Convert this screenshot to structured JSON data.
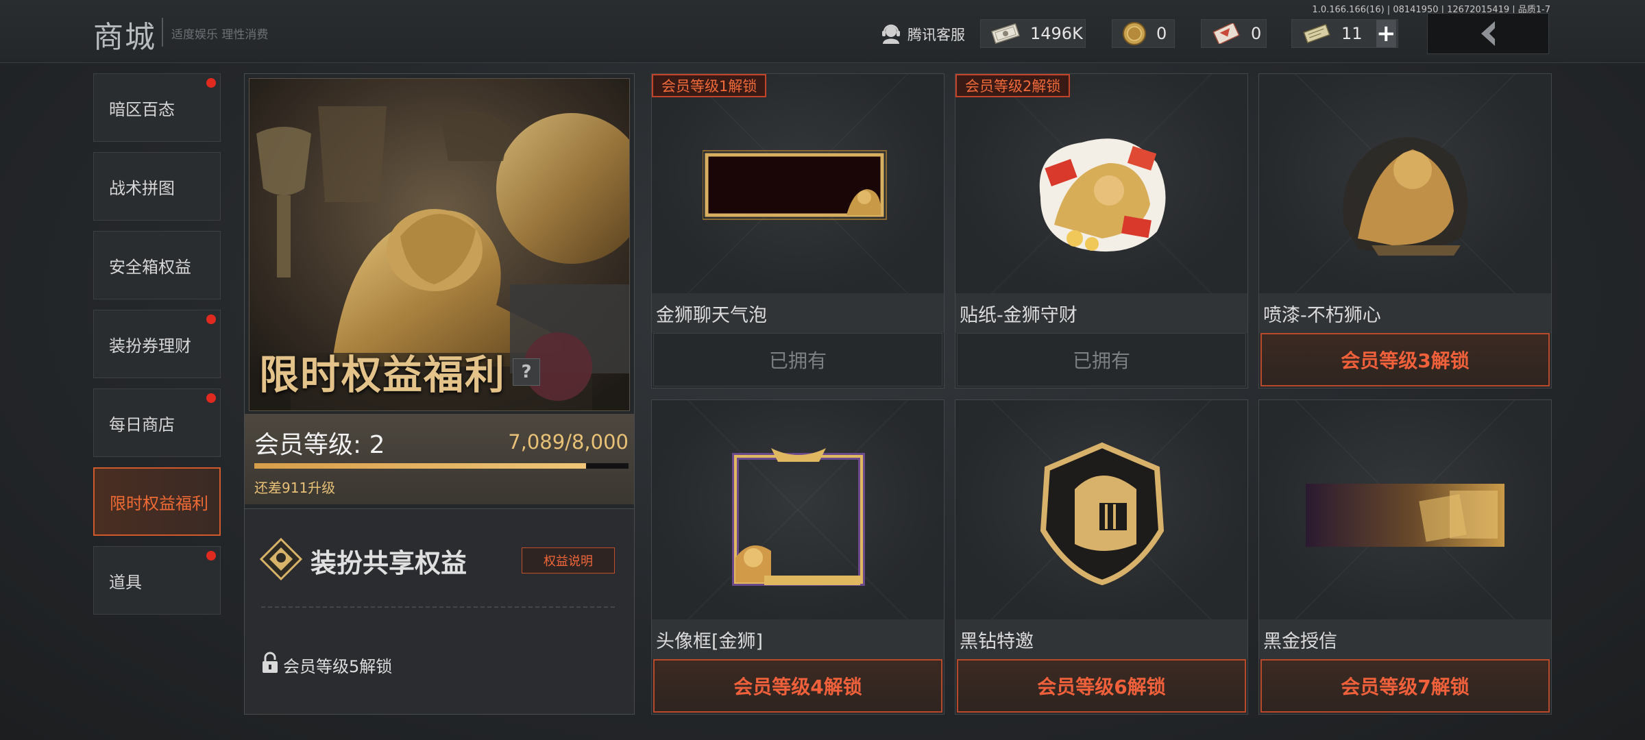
{
  "header": {
    "title": "商城",
    "subtitle": "适度娱乐 理性消费",
    "version": "1.0.166.166(16) | 08141950 | 12672015419 | 品质1-7",
    "service_label": "腾讯客服",
    "currencies": [
      {
        "icon": "cash-icon",
        "value": "1496K"
      },
      {
        "icon": "coin-icon",
        "value": "0"
      },
      {
        "icon": "ticket-icon",
        "value": "0"
      },
      {
        "icon": "voucher-icon",
        "value": "11"
      }
    ],
    "plus_label": "+"
  },
  "sidebar": {
    "items": [
      {
        "label": "暗区百态",
        "badge": true,
        "active": false
      },
      {
        "label": "战术拼图",
        "badge": false,
        "active": false
      },
      {
        "label": "安全箱权益",
        "badge": false,
        "active": false
      },
      {
        "label": "装扮券理财",
        "badge": true,
        "active": false
      },
      {
        "label": "每日商店",
        "badge": true,
        "active": false
      },
      {
        "label": "限时权益福利",
        "badge": false,
        "active": true
      },
      {
        "label": "道具",
        "badge": true,
        "active": false
      }
    ]
  },
  "panel": {
    "hero_title": "限时权益福利",
    "help_label": "?",
    "level_label": "会员等级: 2",
    "exp_text": "7,089/8,000",
    "exp_progress": 0.886,
    "exp_remain": "还差911升级",
    "share_title": "装扮共享权益",
    "share_explain": "权益说明",
    "lock_text": "会员等级5解锁"
  },
  "cards": [
    {
      "ribbon": "会员等级1解锁",
      "name": "金狮聊天气泡",
      "button": "已拥有",
      "owned": true
    },
    {
      "ribbon": "会员等级2解锁",
      "name": "贴纸-金狮守财",
      "button": "已拥有",
      "owned": true
    },
    {
      "ribbon": "",
      "name": "喷漆-不朽狮心",
      "button": "会员等级3解锁",
      "owned": false
    },
    {
      "ribbon": "",
      "name": "头像框[金狮]",
      "button": "会员等级4解锁",
      "owned": false
    },
    {
      "ribbon": "",
      "name": "黑钻特邀",
      "button": "会员等级6解锁",
      "owned": false
    },
    {
      "ribbon": "",
      "name": "黑金授信",
      "button": "会员等级7解锁",
      "owned": false
    }
  ]
}
